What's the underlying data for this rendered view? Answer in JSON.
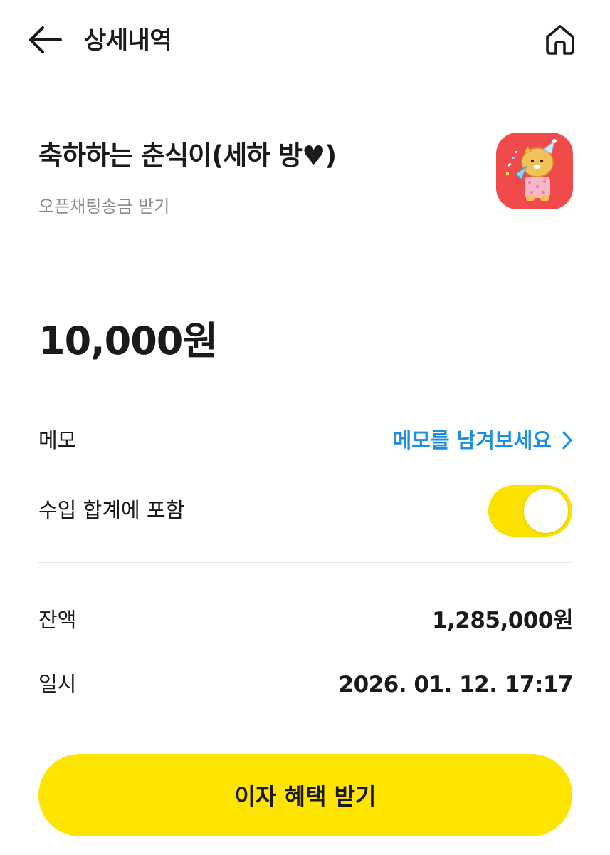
{
  "header": {
    "title": "상세내역",
    "back_icon": "arrow-left-icon",
    "home_icon": "home-icon"
  },
  "transaction": {
    "sender": "축하하는 춘식이(세하 방♥)",
    "type": "오픈채팅송금 받기",
    "sticker_icon": "celebrating-chunsik-sticker",
    "amount": "10,000원"
  },
  "memo": {
    "label": "메모",
    "link_text": "메모를 남겨보세요",
    "link_icon": "chevron-right-icon"
  },
  "income_toggle": {
    "label": "수입 합계에 포함",
    "checked": true
  },
  "details": {
    "balance_label": "잔액",
    "balance_value": "1,285,000원",
    "date_label": "일시",
    "date_value": "2026. 01. 12. 17:17"
  },
  "cta": {
    "label": "이자 혜택 받기"
  },
  "colors": {
    "accent_yellow": "#fee500",
    "link_blue": "#1d8fdf",
    "muted_gray": "#8a8a8a",
    "sticker_bg": "#f04a4a"
  }
}
